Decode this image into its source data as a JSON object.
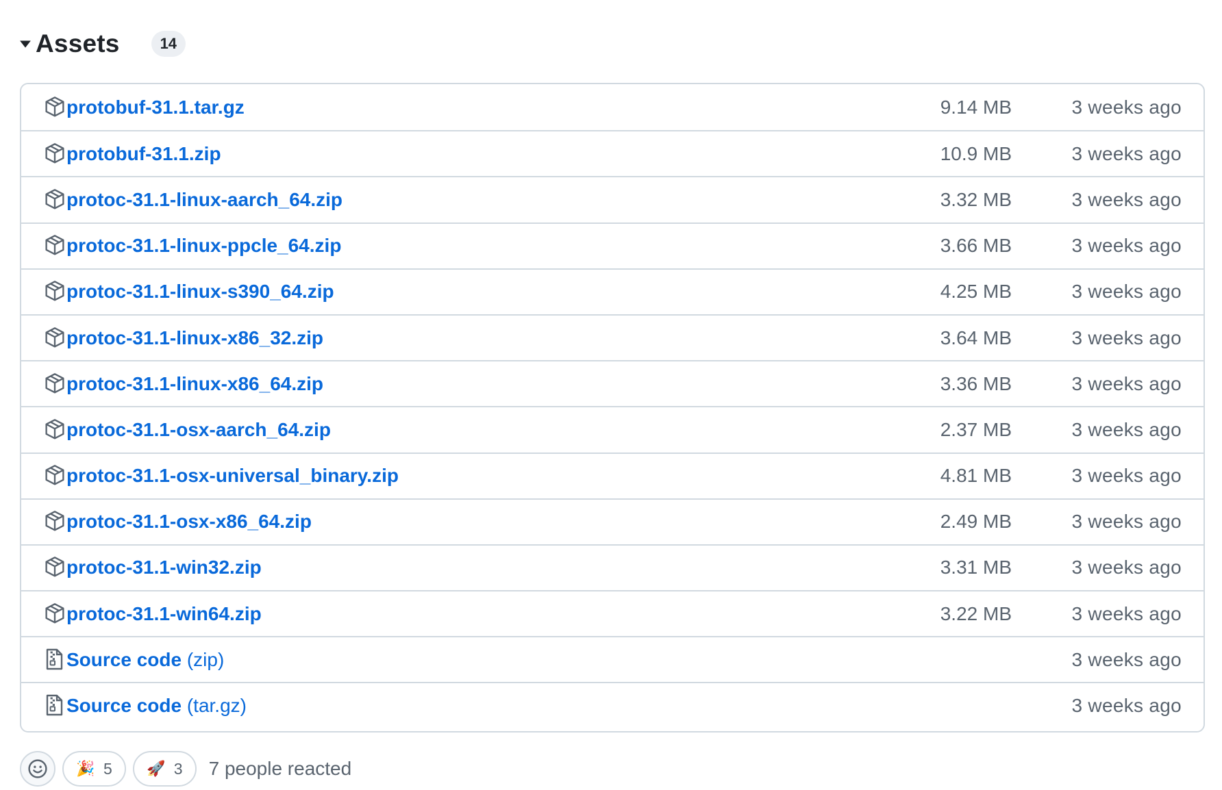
{
  "assets": {
    "title": "Assets",
    "count": "14",
    "rows": [
      {
        "name": "protobuf-31.1.tar.gz",
        "suffix": "",
        "size": "9.14 MB",
        "date": "3 weeks ago",
        "icon": "package-icon"
      },
      {
        "name": "protobuf-31.1.zip",
        "suffix": "",
        "size": "10.9 MB",
        "date": "3 weeks ago",
        "icon": "package-icon"
      },
      {
        "name": "protoc-31.1-linux-aarch_64.zip",
        "suffix": "",
        "size": "3.32 MB",
        "date": "3 weeks ago",
        "icon": "package-icon"
      },
      {
        "name": "protoc-31.1-linux-ppcle_64.zip",
        "suffix": "",
        "size": "3.66 MB",
        "date": "3 weeks ago",
        "icon": "package-icon"
      },
      {
        "name": "protoc-31.1-linux-s390_64.zip",
        "suffix": "",
        "size": "4.25 MB",
        "date": "3 weeks ago",
        "icon": "package-icon"
      },
      {
        "name": "protoc-31.1-linux-x86_32.zip",
        "suffix": "",
        "size": "3.64 MB",
        "date": "3 weeks ago",
        "icon": "package-icon"
      },
      {
        "name": "protoc-31.1-linux-x86_64.zip",
        "suffix": "",
        "size": "3.36 MB",
        "date": "3 weeks ago",
        "icon": "package-icon"
      },
      {
        "name": "protoc-31.1-osx-aarch_64.zip",
        "suffix": "",
        "size": "2.37 MB",
        "date": "3 weeks ago",
        "icon": "package-icon"
      },
      {
        "name": "protoc-31.1-osx-universal_binary.zip",
        "suffix": "",
        "size": "4.81 MB",
        "date": "3 weeks ago",
        "icon": "package-icon"
      },
      {
        "name": "protoc-31.1-osx-x86_64.zip",
        "suffix": "",
        "size": "2.49 MB",
        "date": "3 weeks ago",
        "icon": "package-icon"
      },
      {
        "name": "protoc-31.1-win32.zip",
        "suffix": "",
        "size": "3.31 MB",
        "date": "3 weeks ago",
        "icon": "package-icon"
      },
      {
        "name": "protoc-31.1-win64.zip",
        "suffix": "",
        "size": "3.22 MB",
        "date": "3 weeks ago",
        "icon": "package-icon"
      },
      {
        "name": "Source code",
        "suffix": "(zip)",
        "size": "",
        "date": "3 weeks ago",
        "icon": "file-zip-icon"
      },
      {
        "name": "Source code",
        "suffix": "(tar.gz)",
        "size": "",
        "date": "3 weeks ago",
        "icon": "file-zip-icon"
      }
    ]
  },
  "reactions": {
    "items": [
      {
        "emoji": "🎉",
        "count": "5",
        "icon": "tada-icon"
      },
      {
        "emoji": "🚀",
        "count": "3",
        "icon": "rocket-icon"
      }
    ],
    "summary": "7 people reacted"
  },
  "colors": {
    "link": "#0969da",
    "muted": "#59636e",
    "border": "#d1d9e0"
  }
}
